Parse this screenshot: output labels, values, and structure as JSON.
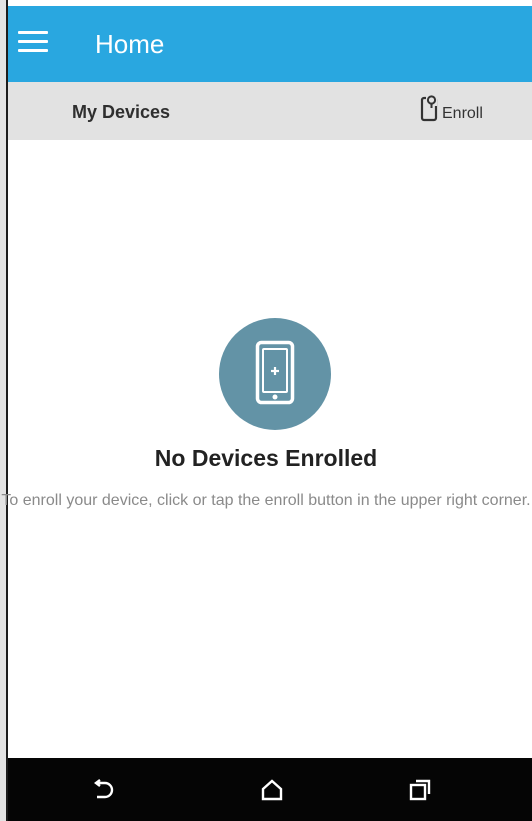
{
  "app_bar": {
    "title": "Home",
    "background_color": "#29a7e0",
    "menu_icon": "hamburger-menu-icon"
  },
  "sub_bar": {
    "title": "My Devices",
    "enroll_label": "Enroll",
    "enroll_icon": "enroll-device-icon"
  },
  "empty_state": {
    "icon": "phone-plus-icon",
    "icon_circle_color": "#6393a6",
    "title": "No Devices Enrolled",
    "description": "To enroll your device, click or tap the enroll button in the upper right corner."
  },
  "nav_bar": {
    "buttons": [
      "back-icon",
      "home-icon",
      "recents-icon"
    ]
  }
}
